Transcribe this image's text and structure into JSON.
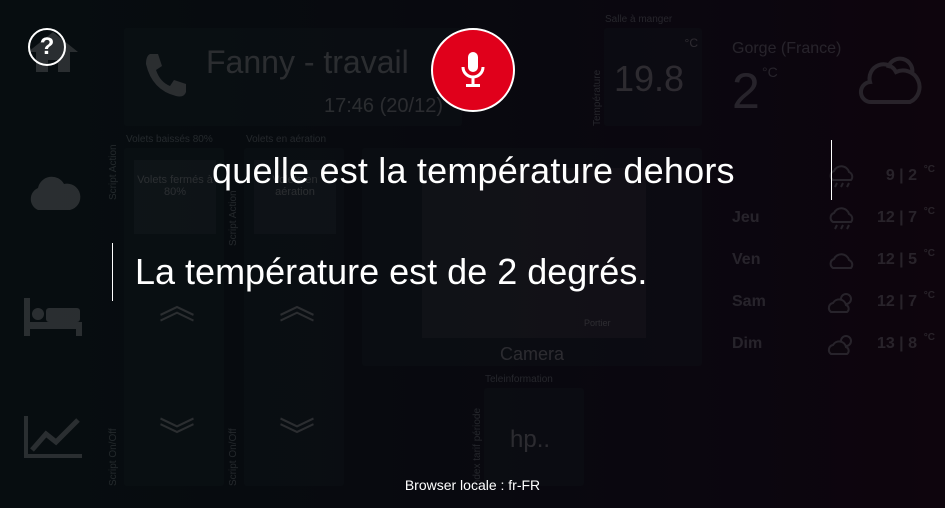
{
  "help_label": "?",
  "dashboard": {
    "call_name": "Fanny - travail",
    "call_time": "17:46 (20/12)",
    "shutter_headers": [
      "Volets baissés 80%",
      "Volets en aération"
    ],
    "shutter_buttons": [
      "Volets fermés à 80%",
      "Volets en aération"
    ],
    "script_labels": [
      "Script Action",
      "Script Action",
      "Script On/Off",
      "Script On/Off"
    ],
    "room_label": "Salle à manger",
    "temp_unit": "°C",
    "temp_side_label": "Température",
    "temperature": "19.8",
    "camera_label": "Camera",
    "camera_overlay": "Portier",
    "teleinfo_label": "Teleinformation",
    "teleinfo_side": "Index tarif période",
    "teleinfo_value": "hp..",
    "weather_location": "Gorge (France)",
    "weather_now": "2",
    "weather_now_unit": "°C",
    "forecast": [
      {
        "day": "",
        "temp": "9 | 2",
        "unit": "°C",
        "icon": "rain-cloud"
      },
      {
        "day": "Jeu",
        "temp": "12 | 7",
        "unit": "°C",
        "icon": "rain-cloud"
      },
      {
        "day": "Ven",
        "temp": "12 | 5",
        "unit": "°C",
        "icon": "cloud"
      },
      {
        "day": "Sam",
        "temp": "12 | 7",
        "unit": "°C",
        "icon": "sun-cloud"
      },
      {
        "day": "Dim",
        "temp": "13 | 8",
        "unit": "°C",
        "icon": "sun-cloud"
      }
    ]
  },
  "voice": {
    "query": "quelle est la température dehors",
    "answer": "La température est de 2 degrés.",
    "locale": "Browser locale : fr-FR"
  },
  "colors": {
    "mic": "#e0001b"
  }
}
